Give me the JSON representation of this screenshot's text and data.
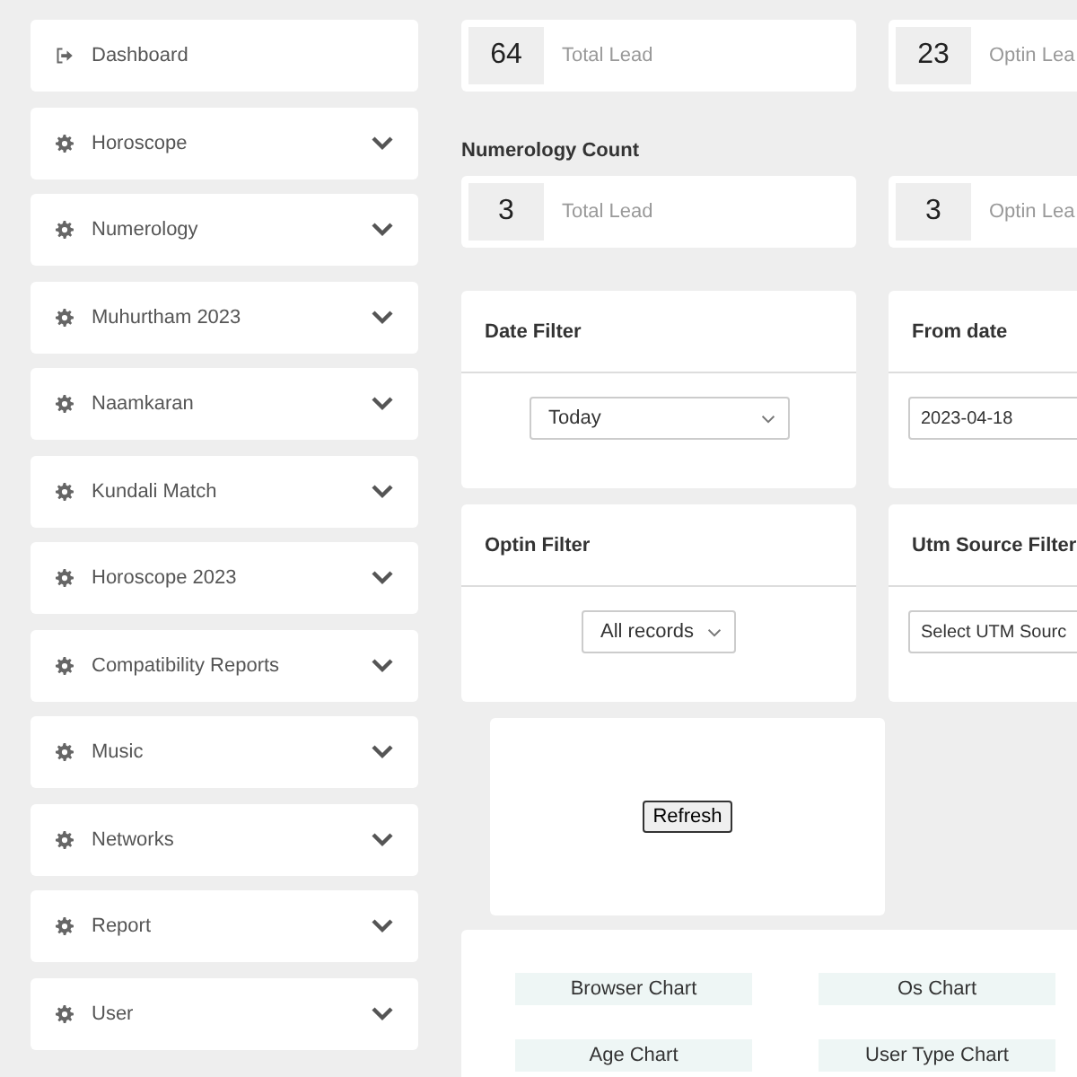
{
  "sidebar": {
    "items": [
      {
        "kind": "link",
        "label": "Dashboard"
      },
      {
        "kind": "menu",
        "label": "Horoscope",
        "expanded": false
      },
      {
        "kind": "menu",
        "label": "Numerology",
        "expanded": false
      },
      {
        "kind": "menu",
        "label": "Muhurtham 2023",
        "expanded": false
      },
      {
        "kind": "menu",
        "label": "Naamkaran",
        "expanded": false
      },
      {
        "kind": "menu",
        "label": "Kundali Match",
        "expanded": false
      },
      {
        "kind": "menu",
        "label": "Horoscope 2023",
        "expanded": false
      },
      {
        "kind": "menu",
        "label": "Compatibility Reports",
        "expanded": false
      },
      {
        "kind": "menu",
        "label": "Music",
        "expanded": false
      },
      {
        "kind": "menu",
        "label": "Networks",
        "expanded": false
      },
      {
        "kind": "menu",
        "label": "Report",
        "expanded": false
      },
      {
        "kind": "menu",
        "label": "User",
        "expanded": false
      }
    ]
  },
  "stats": [
    {
      "value": "64",
      "label": "Total Lead"
    },
    {
      "value": "23",
      "label": "Optin Lea"
    }
  ],
  "numerology": {
    "title": "Numerology Count",
    "stats": [
      {
        "value": "3",
        "label": "Total Lead"
      },
      {
        "value": "3",
        "label": "Optin Lea"
      }
    ]
  },
  "filters": [
    {
      "title": "Date Filter",
      "kind": "select",
      "value": "Today"
    },
    {
      "title": "From date",
      "kind": "input",
      "value": "2023-04-18"
    },
    {
      "title": "Optin Filter",
      "kind": "select",
      "value": "All records"
    },
    {
      "title": "Utm Source Filter",
      "kind": "input",
      "value": "Select UTM Sourc"
    }
  ],
  "refresh_button": "Refresh",
  "chart_buttons": [
    "Browser Chart",
    "Os Chart",
    "Age Chart",
    "User Type Chart"
  ]
}
